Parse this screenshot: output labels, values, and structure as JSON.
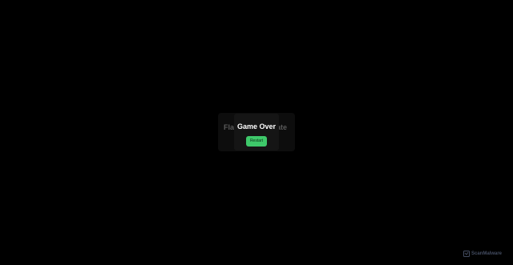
{
  "game": {
    "title_left_fragment": "Fla",
    "title_right_fragment": "ate"
  },
  "modal": {
    "title": "Game Over",
    "restart_label": "Restart"
  },
  "watermark": {
    "text": "ScanMalware",
    "icon": "scanmalware-logo-icon"
  },
  "colors": {
    "background": "#000000",
    "modal": "#151515",
    "restart_button": "#3ec96a"
  }
}
